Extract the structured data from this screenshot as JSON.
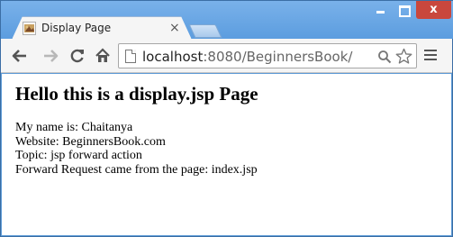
{
  "tab": {
    "title": "Display Page",
    "close_glyph": "×",
    "favicon": "jsp-page-icon"
  },
  "window_controls": {
    "close_glyph": "x"
  },
  "toolbar": {
    "back": "back-arrow-icon",
    "forward": "forward-arrow-icon",
    "reload": "reload-icon",
    "home": "home-icon",
    "menu": "hamburger-menu-icon"
  },
  "address": {
    "host": "localhost",
    "path": ":8080/BeginnersBook/"
  },
  "page": {
    "heading": "Hello this is a display.jsp Page",
    "lines": [
      "My name is: Chaitanya",
      "Website: BeginnersBook.com",
      "Topic: jsp forward action",
      "Forward Request came from the page: index.jsp"
    ]
  },
  "colors": {
    "titlebar": "#5c9ddf",
    "close_button": "#c9473d",
    "toolbar": "#f5f5f5"
  }
}
